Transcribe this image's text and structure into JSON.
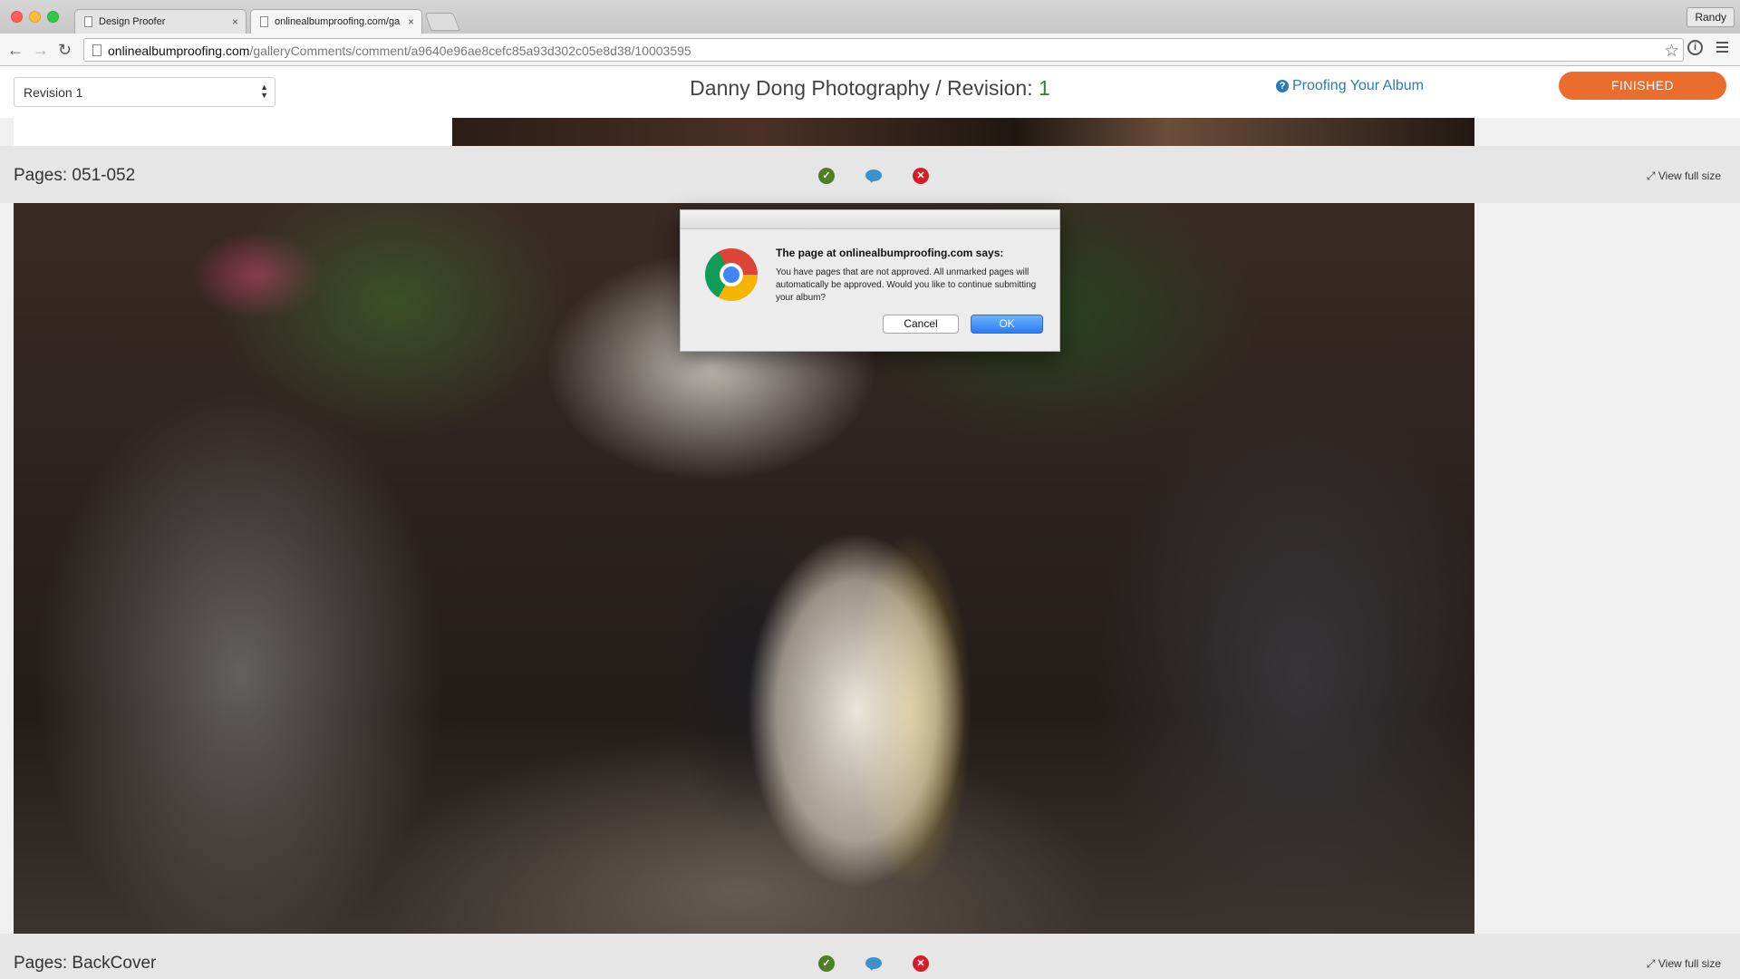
{
  "browser": {
    "tabs": [
      {
        "title": "Design Proofer",
        "close": "×"
      },
      {
        "title": "onlinealbumproofing.com/ga",
        "close": "×"
      }
    ],
    "profile": "Randy",
    "url_host": "onlinealbumproofing.com",
    "url_path": "/galleryComments/comment/a9640e96ae8cefc85a93d302c05e8d38/10003595"
  },
  "header": {
    "revision_select": "Revision 1",
    "title_prefix": "Danny Dong Photography / Revision: ",
    "title_revision": "1",
    "help_link": "Proofing Your Album",
    "finished_button": "FINISHED"
  },
  "pages": [
    {
      "label": "Pages: 051-052",
      "view_full": "View full size"
    },
    {
      "label": "Pages: BackCover",
      "view_full": "View full size"
    }
  ],
  "dialog": {
    "title": "The page at onlinealbumproofing.com says:",
    "message": "You have pages that are not approved. All unmarked pages will automatically be approved. Would you like to continue submitting your album?",
    "cancel": "Cancel",
    "ok": "OK"
  },
  "icons": {
    "approve": "check-circle",
    "comment": "speech-bubble",
    "reject": "x-circle"
  },
  "colors": {
    "finished": "#eb6d2d",
    "approve": "#4d7f27",
    "comment": "#3a92c9",
    "reject": "#d32027",
    "link": "#2c7bb6"
  }
}
